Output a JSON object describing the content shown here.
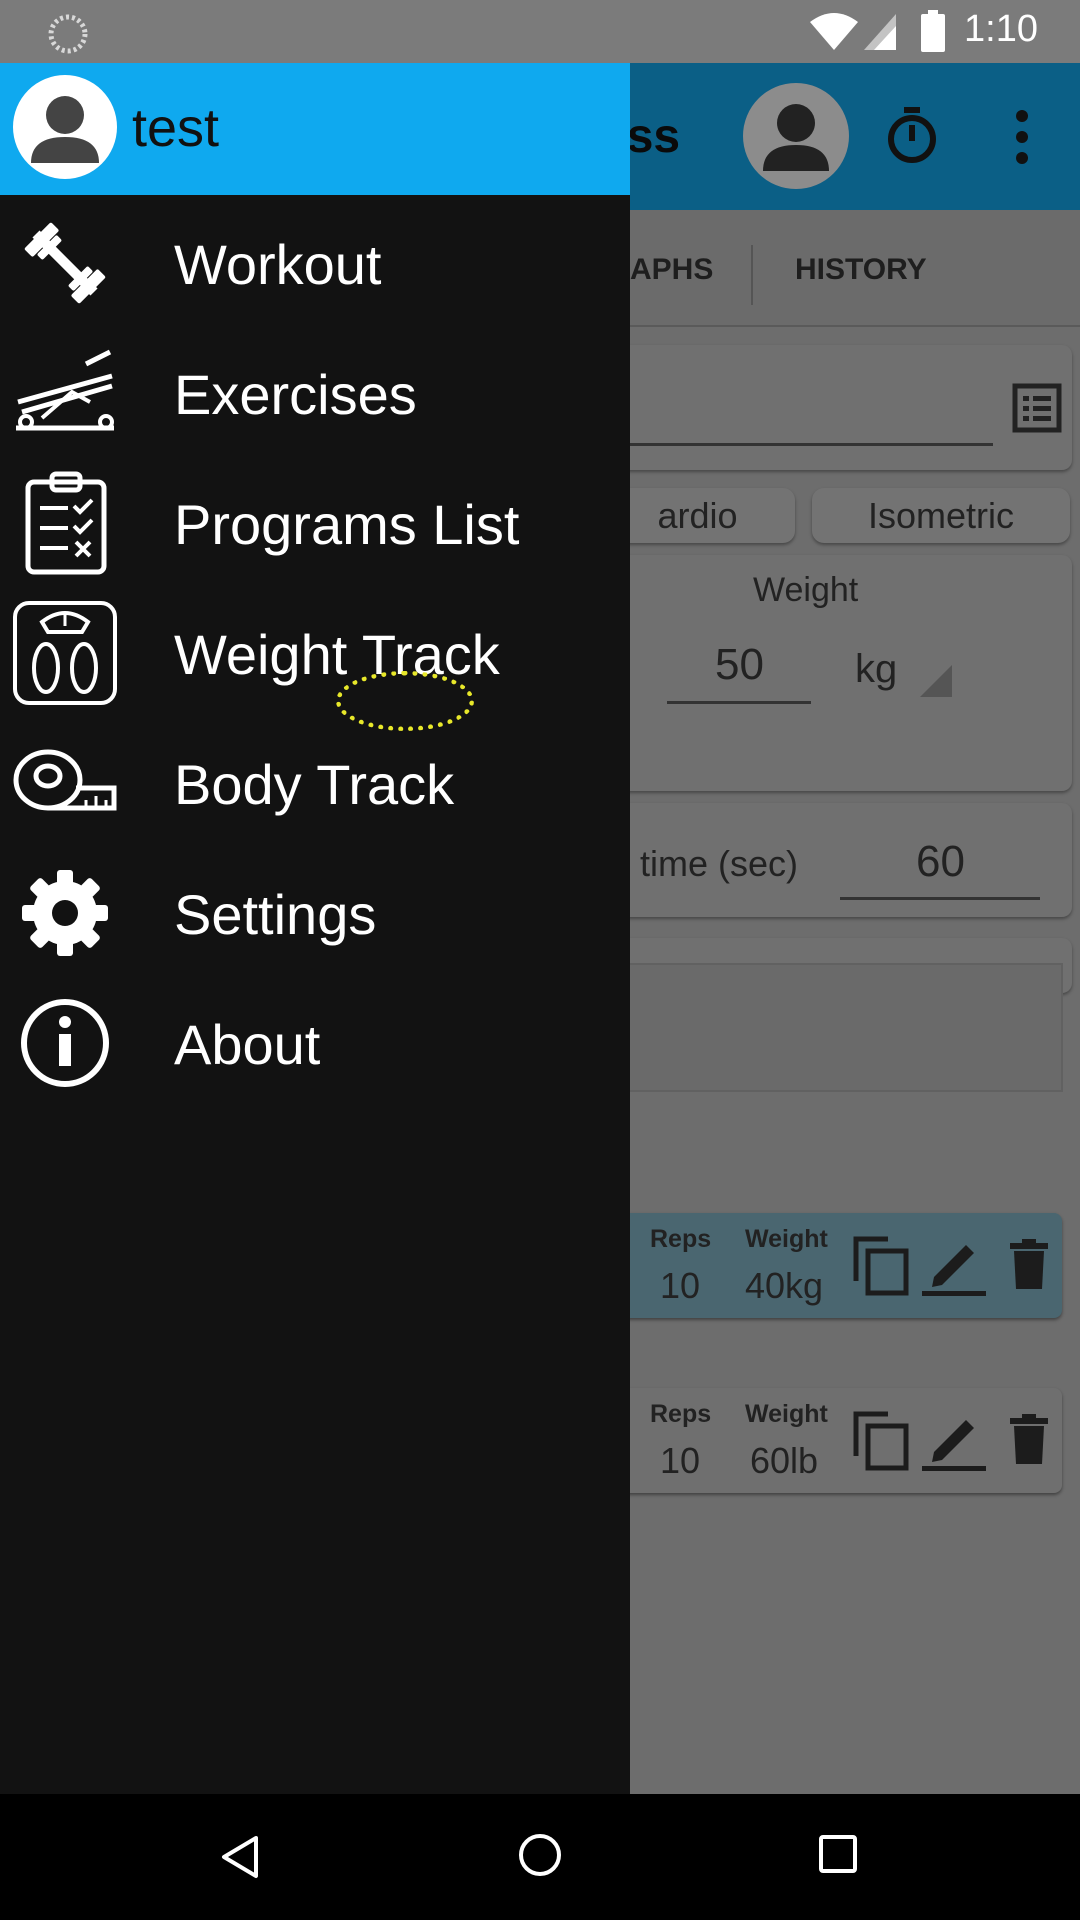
{
  "status_bar": {
    "time": "1:10",
    "icons": [
      "loading-icon",
      "wifi-icon",
      "signal-icon",
      "battery-icon"
    ]
  },
  "background_app": {
    "toolbar": {
      "title_partial": "ess",
      "icons": [
        "avatar",
        "timer-icon",
        "overflow-menu-icon"
      ]
    },
    "tabs": [
      "APHS",
      "HISTORY"
    ],
    "type_chips": [
      "ardio",
      "Isometric"
    ],
    "weight": {
      "label": "Weight",
      "value": "50",
      "unit": "kg"
    },
    "rest": {
      "label": "time (sec)",
      "value": "60"
    },
    "sets": [
      {
        "reps_label": "Reps",
        "weight_label": "Weight",
        "reps": "10",
        "weight": "40kg"
      },
      {
        "reps_label": "Reps",
        "weight_label": "Weight",
        "reps": "10",
        "weight": "60lb"
      }
    ]
  },
  "drawer": {
    "user": {
      "name": "test"
    },
    "items": [
      {
        "label": "Workout",
        "icon": "dumbbell-icon"
      },
      {
        "label": "Exercises",
        "icon": "leg-press-icon"
      },
      {
        "label": "Programs List",
        "icon": "clipboard-checklist-icon"
      },
      {
        "label": "Weight Track",
        "icon": "scale-icon"
      },
      {
        "label": "Body Track",
        "icon": "tape-measure-icon"
      },
      {
        "label": "Settings",
        "icon": "gear-icon"
      },
      {
        "label": "About",
        "icon": "info-icon"
      }
    ]
  },
  "colors": {
    "drawer_header": "#0fa9ef",
    "drawer_bg": "#121212",
    "toolbar": "#0b5f86"
  },
  "navigation_bar": {
    "buttons": [
      "back-icon",
      "home-icon",
      "recents-icon"
    ]
  }
}
